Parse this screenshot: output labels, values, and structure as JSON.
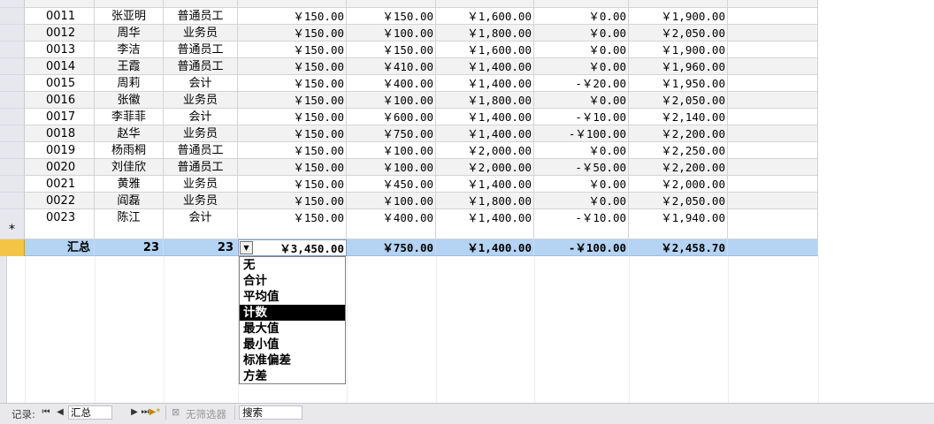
{
  "rows": [
    {
      "id": "0011",
      "name": "张亚明",
      "role": "普通员工",
      "base": "￥150.00",
      "subsidy": "￥150.00",
      "bonus": "￥1,600.00",
      "deduction": "￥0.00",
      "total": "￥1,900.00"
    },
    {
      "id": "0012",
      "name": "周华",
      "role": "业务员",
      "base": "￥150.00",
      "subsidy": "￥100.00",
      "bonus": "￥1,800.00",
      "deduction": "￥0.00",
      "total": "￥2,050.00"
    },
    {
      "id": "0013",
      "name": "李洁",
      "role": "普通员工",
      "base": "￥150.00",
      "subsidy": "￥150.00",
      "bonus": "￥1,600.00",
      "deduction": "￥0.00",
      "total": "￥1,900.00"
    },
    {
      "id": "0014",
      "name": "王霞",
      "role": "普通员工",
      "base": "￥150.00",
      "subsidy": "￥410.00",
      "bonus": "￥1,400.00",
      "deduction": "￥0.00",
      "total": "￥1,960.00"
    },
    {
      "id": "0015",
      "name": "周莉",
      "role": "会计",
      "base": "￥150.00",
      "subsidy": "￥400.00",
      "bonus": "￥1,400.00",
      "deduction": "-￥20.00",
      "total": "￥1,950.00"
    },
    {
      "id": "0016",
      "name": "张徽",
      "role": "业务员",
      "base": "￥150.00",
      "subsidy": "￥100.00",
      "bonus": "￥1,800.00",
      "deduction": "￥0.00",
      "total": "￥2,050.00"
    },
    {
      "id": "0017",
      "name": "李菲菲",
      "role": "会计",
      "base": "￥150.00",
      "subsidy": "￥600.00",
      "bonus": "￥1,400.00",
      "deduction": "-￥10.00",
      "total": "￥2,140.00"
    },
    {
      "id": "0018",
      "name": "赵华",
      "role": "业务员",
      "base": "￥150.00",
      "subsidy": "￥750.00",
      "bonus": "￥1,400.00",
      "deduction": "-￥100.00",
      "total": "￥2,200.00"
    },
    {
      "id": "0019",
      "name": "杨雨桐",
      "role": "普通员工",
      "base": "￥150.00",
      "subsidy": "￥100.00",
      "bonus": "￥2,000.00",
      "deduction": "￥0.00",
      "total": "￥2,250.00"
    },
    {
      "id": "0020",
      "name": "刘佳欣",
      "role": "普通员工",
      "base": "￥150.00",
      "subsidy": "￥100.00",
      "bonus": "￥2,000.00",
      "deduction": "-￥50.00",
      "total": "￥2,200.00"
    },
    {
      "id": "0021",
      "name": "黄雅",
      "role": "业务员",
      "base": "￥150.00",
      "subsidy": "￥450.00",
      "bonus": "￥1,400.00",
      "deduction": "￥0.00",
      "total": "￥2,000.00"
    },
    {
      "id": "0022",
      "name": "阎磊",
      "role": "业务员",
      "base": "￥150.00",
      "subsidy": "￥100.00",
      "bonus": "￥1,800.00",
      "deduction": "￥0.00",
      "total": "￥2,050.00"
    },
    {
      "id": "0023",
      "name": "陈江",
      "role": "会计",
      "base": "￥150.00",
      "subsidy": "￥400.00",
      "bonus": "￥1,400.00",
      "deduction": "-￥10.00",
      "total": "￥1,940.00"
    }
  ],
  "new_row_marker": "*",
  "totals": {
    "label": "汇总",
    "name_count": "23",
    "role_count": "23",
    "base": "￥3,450.00",
    "subsidy": "￥750.00",
    "bonus": "￥1,400.00",
    "deduction": "-￥100.00",
    "total": "￥2,458.70"
  },
  "dropdown": {
    "options": [
      "无",
      "合计",
      "平均值",
      "计数",
      "最大值",
      "最小值",
      "标准偏差",
      "方差"
    ],
    "selected": "计数"
  },
  "navbar": {
    "record_label": "记录:",
    "first": "⏮",
    "prev": "◀",
    "current": "汇总",
    "next": "▶",
    "last": "⏭",
    "new": "▶*",
    "filter_label": "无筛选器",
    "search_placeholder": "搜索"
  }
}
